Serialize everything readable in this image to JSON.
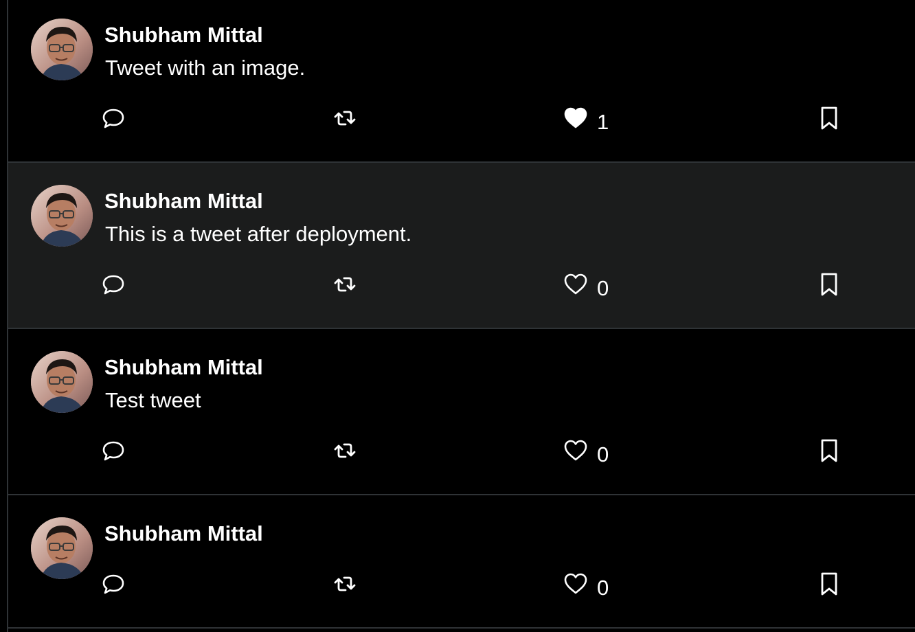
{
  "colors": {
    "background": "#000000",
    "hover_background": "#1b1c1c",
    "divider": "#2f3336",
    "text": "#ffffff"
  },
  "tweets": [
    {
      "author": "Shubham Mittal",
      "text": "Tweet with an image.",
      "likes": "1",
      "liked": true
    },
    {
      "author": "Shubham Mittal",
      "text": "This is a tweet after deployment.",
      "likes": "0",
      "liked": false,
      "hovered": true
    },
    {
      "author": "Shubham Mittal",
      "text": "Test tweet",
      "likes": "0",
      "liked": false
    },
    {
      "author": "Shubham Mittal",
      "text": "",
      "likes": "0",
      "liked": false
    }
  ],
  "icons": {
    "reply": "reply-icon",
    "retweet": "retweet-icon",
    "like": "heart-icon",
    "liked": "heart-filled-icon",
    "bookmark": "bookmark-icon",
    "avatar": "avatar-photo"
  }
}
